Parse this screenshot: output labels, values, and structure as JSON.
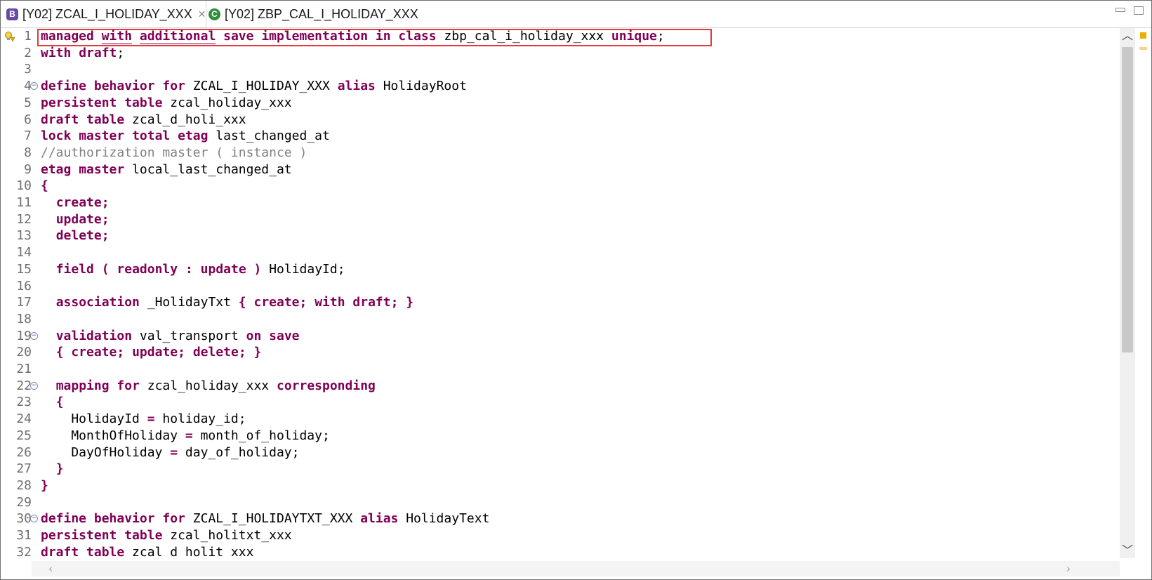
{
  "tabs": [
    {
      "label": "[Y02] ZCAL_I_HOLIDAY_XXX",
      "icon": "behavior-definition-icon",
      "close": "✕"
    },
    {
      "label": "[Y02] ZBP_CAL_I_HOLIDAY_XXX",
      "icon": "abap-class-icon"
    }
  ],
  "colors": {
    "keyword": "#7f0055",
    "comment": "#808080",
    "highlight_box": "#e03c3c",
    "line_number": "#6f6f6f"
  },
  "code": {
    "lines": [
      {
        "n": "1",
        "parts": [
          [
            "kw",
            "managed"
          ],
          [
            "t",
            " "
          ],
          [
            "kwu",
            "with"
          ],
          [
            "t",
            " "
          ],
          [
            "kwu",
            "additional"
          ],
          [
            "t",
            " "
          ],
          [
            "kw",
            "save"
          ],
          [
            "t",
            " "
          ],
          [
            "kw",
            "implementation"
          ],
          [
            "t",
            " "
          ],
          [
            "kw",
            "in"
          ],
          [
            "t",
            " "
          ],
          [
            "kw",
            "class"
          ],
          [
            "t",
            " zbp_cal_i_holiday_xxx "
          ],
          [
            "kw",
            "unique"
          ],
          [
            "t",
            ";"
          ]
        ]
      },
      {
        "n": "2",
        "parts": [
          [
            "kw",
            "with"
          ],
          [
            "t",
            " "
          ],
          [
            "kw",
            "draft"
          ],
          [
            "t",
            ";"
          ]
        ]
      },
      {
        "n": "3",
        "parts": []
      },
      {
        "n": "4",
        "fold": true,
        "parts": [
          [
            "kw",
            "define"
          ],
          [
            "t",
            " "
          ],
          [
            "kw",
            "behavior"
          ],
          [
            "t",
            " "
          ],
          [
            "kw",
            "for"
          ],
          [
            "t",
            " ZCAL_I_HOLIDAY_XXX "
          ],
          [
            "kw",
            "alias"
          ],
          [
            "t",
            " HolidayRoot"
          ]
        ]
      },
      {
        "n": "5",
        "parts": [
          [
            "kw",
            "persistent"
          ],
          [
            "t",
            " "
          ],
          [
            "kw",
            "table"
          ],
          [
            "t",
            " zcal_holiday_xxx"
          ]
        ]
      },
      {
        "n": "6",
        "parts": [
          [
            "kw",
            "draft"
          ],
          [
            "t",
            " "
          ],
          [
            "kw",
            "table"
          ],
          [
            "t",
            " zcal_d_holi_xxx"
          ]
        ]
      },
      {
        "n": "7",
        "parts": [
          [
            "kw",
            "lock"
          ],
          [
            "t",
            " "
          ],
          [
            "kw",
            "master"
          ],
          [
            "t",
            " "
          ],
          [
            "kw",
            "total"
          ],
          [
            "t",
            " "
          ],
          [
            "kw",
            "etag"
          ],
          [
            "t",
            " last_changed_at"
          ]
        ]
      },
      {
        "n": "8",
        "parts": [
          [
            "cm",
            "//authorization master ( instance )"
          ]
        ]
      },
      {
        "n": "9",
        "parts": [
          [
            "kw",
            "etag"
          ],
          [
            "t",
            " "
          ],
          [
            "kw",
            "master"
          ],
          [
            "t",
            " local_last_changed_at"
          ]
        ]
      },
      {
        "n": "10",
        "parts": [
          [
            "kw",
            "{"
          ]
        ]
      },
      {
        "n": "11",
        "parts": [
          [
            "t",
            "  "
          ],
          [
            "kw",
            "create"
          ],
          [
            "kw",
            ";"
          ]
        ]
      },
      {
        "n": "12",
        "parts": [
          [
            "t",
            "  "
          ],
          [
            "kw",
            "update"
          ],
          [
            "kw",
            ";"
          ]
        ]
      },
      {
        "n": "13",
        "parts": [
          [
            "t",
            "  "
          ],
          [
            "kw",
            "delete"
          ],
          [
            "kw",
            ";"
          ]
        ]
      },
      {
        "n": "14",
        "parts": []
      },
      {
        "n": "15",
        "parts": [
          [
            "t",
            "  "
          ],
          [
            "kw",
            "field"
          ],
          [
            "t",
            " "
          ],
          [
            "kw",
            "("
          ],
          [
            "t",
            " "
          ],
          [
            "kw",
            "readonly"
          ],
          [
            "t",
            " "
          ],
          [
            "kw",
            ":"
          ],
          [
            "t",
            " "
          ],
          [
            "kw",
            "update"
          ],
          [
            "t",
            " "
          ],
          [
            "kw",
            ")"
          ],
          [
            "t",
            " HolidayId;"
          ]
        ]
      },
      {
        "n": "16",
        "parts": []
      },
      {
        "n": "17",
        "parts": [
          [
            "t",
            "  "
          ],
          [
            "kw",
            "association"
          ],
          [
            "t",
            " _HolidayTxt "
          ],
          [
            "kw",
            "{"
          ],
          [
            "t",
            " "
          ],
          [
            "kw",
            "create"
          ],
          [
            "kw",
            ";"
          ],
          [
            "t",
            " "
          ],
          [
            "kw",
            "with"
          ],
          [
            "t",
            " "
          ],
          [
            "kw",
            "draft"
          ],
          [
            "kw",
            ";"
          ],
          [
            "t",
            " "
          ],
          [
            "kw",
            "}"
          ]
        ]
      },
      {
        "n": "18",
        "parts": []
      },
      {
        "n": "19",
        "fold": true,
        "parts": [
          [
            "t",
            "  "
          ],
          [
            "kw",
            "validation"
          ],
          [
            "t",
            " val_transport "
          ],
          [
            "kw",
            "on"
          ],
          [
            "t",
            " "
          ],
          [
            "kw",
            "save"
          ]
        ]
      },
      {
        "n": "20",
        "parts": [
          [
            "t",
            "  "
          ],
          [
            "kw",
            "{"
          ],
          [
            "t",
            " "
          ],
          [
            "kw",
            "create"
          ],
          [
            "kw",
            ";"
          ],
          [
            "t",
            " "
          ],
          [
            "kw",
            "update"
          ],
          [
            "kw",
            ";"
          ],
          [
            "t",
            " "
          ],
          [
            "kw",
            "delete"
          ],
          [
            "kw",
            ";"
          ],
          [
            "t",
            " "
          ],
          [
            "kw",
            "}"
          ]
        ]
      },
      {
        "n": "21",
        "parts": []
      },
      {
        "n": "22",
        "fold": true,
        "parts": [
          [
            "t",
            "  "
          ],
          [
            "kw",
            "mapping"
          ],
          [
            "t",
            " "
          ],
          [
            "kw",
            "for"
          ],
          [
            "t",
            " zcal_holiday_xxx "
          ],
          [
            "kw",
            "corresponding"
          ]
        ]
      },
      {
        "n": "23",
        "parts": [
          [
            "t",
            "  "
          ],
          [
            "kw",
            "{"
          ]
        ]
      },
      {
        "n": "24",
        "parts": [
          [
            "t",
            "    HolidayId "
          ],
          [
            "kw",
            "="
          ],
          [
            "t",
            " holiday_id;"
          ]
        ]
      },
      {
        "n": "25",
        "parts": [
          [
            "t",
            "    MonthOfHoliday "
          ],
          [
            "kw",
            "="
          ],
          [
            "t",
            " month_of_holiday;"
          ]
        ]
      },
      {
        "n": "26",
        "parts": [
          [
            "t",
            "    DayOfHoliday "
          ],
          [
            "kw",
            "="
          ],
          [
            "t",
            " day_of_holiday;"
          ]
        ]
      },
      {
        "n": "27",
        "parts": [
          [
            "t",
            "  "
          ],
          [
            "kw",
            "}"
          ]
        ]
      },
      {
        "n": "28",
        "parts": [
          [
            "kw",
            "}"
          ]
        ]
      },
      {
        "n": "29",
        "parts": []
      },
      {
        "n": "30",
        "fold": true,
        "parts": [
          [
            "kw",
            "define"
          ],
          [
            "t",
            " "
          ],
          [
            "kw",
            "behavior"
          ],
          [
            "t",
            " "
          ],
          [
            "kw",
            "for"
          ],
          [
            "t",
            " ZCAL_I_HOLIDAYTXT_XXX "
          ],
          [
            "kw",
            "alias"
          ],
          [
            "t",
            " HolidayText"
          ]
        ]
      },
      {
        "n": "31",
        "parts": [
          [
            "kw",
            "persistent"
          ],
          [
            "t",
            " "
          ],
          [
            "kw",
            "table"
          ],
          [
            "t",
            " zcal_holitxt_xxx"
          ]
        ]
      },
      {
        "n": "32",
        "parts": [
          [
            "kw",
            "draft"
          ],
          [
            "t",
            " "
          ],
          [
            "kw",
            "table"
          ],
          [
            "t",
            " zcal_d_holit_xxx"
          ]
        ]
      }
    ]
  },
  "scroll": {
    "up_glyph": "︿",
    "down_glyph": "﹀",
    "left_glyph": "‹",
    "right_glyph": "›"
  }
}
